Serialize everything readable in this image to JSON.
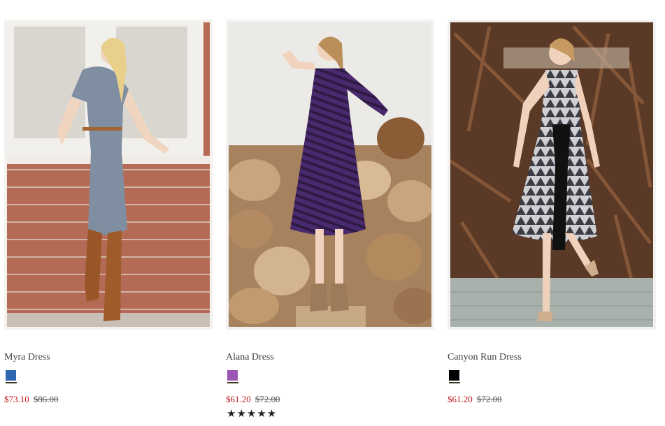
{
  "products": [
    {
      "name": "Myra Dress",
      "swatch_color": "#2f66b0",
      "sale_price": "$73.10",
      "original_price": "$86.00",
      "rating_stars": ""
    },
    {
      "name": "Alana Dress",
      "swatch_color": "#9b55b3",
      "sale_price": "$61.20",
      "original_price": "$72.00",
      "rating_stars": "★★★★★"
    },
    {
      "name": "Canyon Run Dress",
      "swatch_color": "#000000",
      "sale_price": "$61.20",
      "original_price": "$72.00",
      "rating_stars": ""
    }
  ],
  "colors": {
    "sale_price": "#c0151b",
    "original_price": "#555555",
    "product_name": "#444444"
  }
}
